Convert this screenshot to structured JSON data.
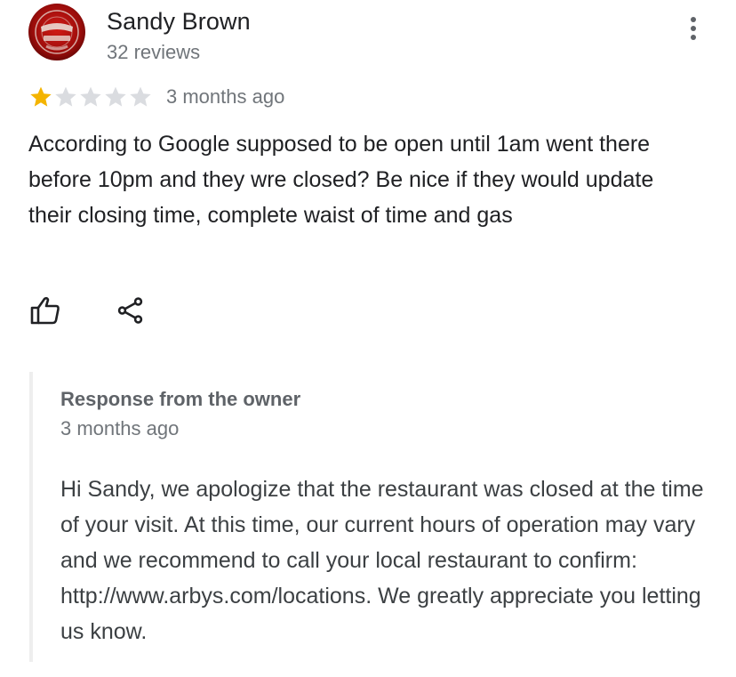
{
  "review": {
    "reviewer_name": "Sandy Brown",
    "review_count": "32 reviews",
    "avatar_icon": "ohio-state-logo-avatar",
    "rating": 1,
    "rating_max": 5,
    "time": "3 months ago",
    "text": "According to Google supposed to be open until 1am went there before 10pm and they wre closed? Be nice if they would update their closing time, complete waist of time and gas",
    "more_icon": "more-vert-icon",
    "like_icon": "thumbs-up-icon",
    "share_icon": "share-icon"
  },
  "owner_response": {
    "title": "Response from the owner",
    "time": "3 months ago",
    "text": "Hi Sandy, we apologize that the restaurant was closed at the time of your visit. At this time, our current hours of operation may vary and we recommend to call your local restaurant to confirm: http://www.arbys.com/locations. We greatly appreciate you letting us know."
  },
  "colors": {
    "star_filled": "#f4b400",
    "star_empty": "#dadce0",
    "primary_text": "#202124",
    "secondary_text": "#70757a",
    "owner_title": "#5f6368",
    "response_border": "#eeeeee",
    "avatar_red": "#b3100f"
  }
}
